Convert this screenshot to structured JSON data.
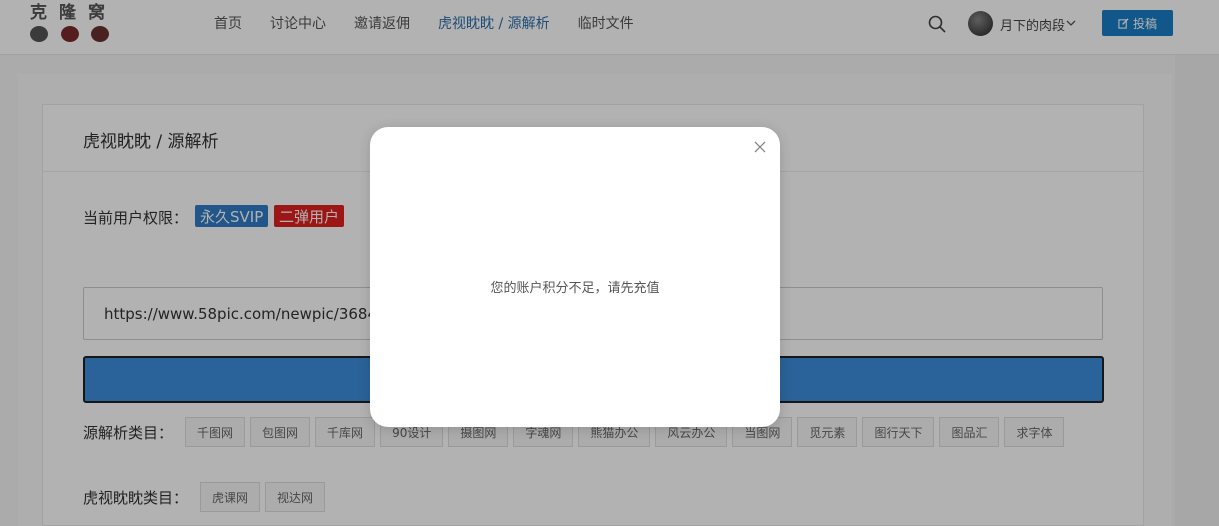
{
  "header": {
    "logo_text": "克隆窝",
    "nav": [
      {
        "label": "首页",
        "active": false
      },
      {
        "label": "讨论中心",
        "active": false
      },
      {
        "label": "邀请返佣",
        "active": false
      },
      {
        "label": "虎视眈眈 / 源解析",
        "active": true
      },
      {
        "label": "临时文件",
        "active": false
      }
    ],
    "search_icon": "search-icon",
    "username": "月下的肉段",
    "post_button_label": "投稿",
    "accent_color": "#1a7dc4"
  },
  "page": {
    "title": "虎视眈眈 / 源解析",
    "permission_label": "当前用户权限：",
    "badges": [
      {
        "label": "永久SVIP",
        "color": "#2e7bc6"
      },
      {
        "label": "二弹用户",
        "color": "#e02020"
      }
    ],
    "url_value": "https://www.58pic.com/newpic/36847",
    "source_label": "源解析类目：",
    "source_tags": [
      "千图网",
      "包图网",
      "千库网",
      "90设计",
      "摄图网",
      "字魂网",
      "熊猫办公",
      "风云办公",
      "当图网",
      "觅元素",
      "图行天下",
      "图品汇",
      "求字体"
    ],
    "tiger_label": "虎视眈眈类目：",
    "tiger_tags": [
      "虎课网",
      "视达网"
    ]
  },
  "modal": {
    "message": "您的账户积分不足，请先充值",
    "close_icon": "close-icon"
  }
}
